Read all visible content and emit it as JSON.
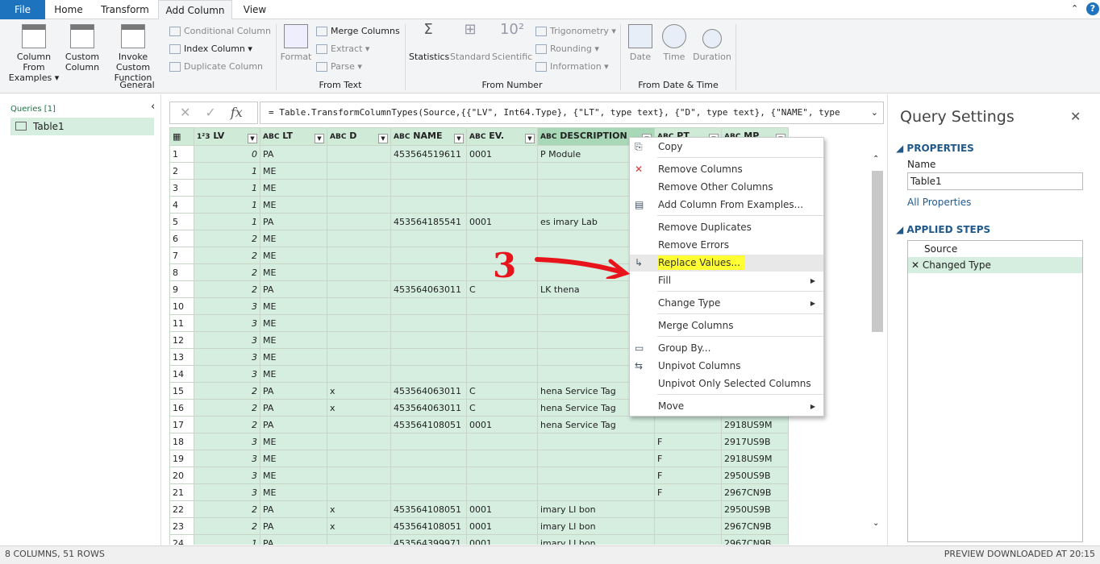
{
  "tabs": [
    "File",
    "Home",
    "Transform",
    "Add Column",
    "View"
  ],
  "ribbon": {
    "column_from_examples": "Column From Examples",
    "custom_column": "Custom Column",
    "invoke_custom_function": "Invoke Custom Function",
    "conditional_column": "Conditional Column",
    "index_column": "Index Column",
    "duplicate_column": "Duplicate Column",
    "general": "General",
    "format": "Format",
    "merge_columns": "Merge Columns",
    "extract": "Extract",
    "parse": "Parse",
    "from_text": "From Text",
    "statistics": "Statistics",
    "standard": "Standard",
    "scientific": "Scientific",
    "trigonometry": "Trigonometry",
    "rounding": "Rounding",
    "information": "Information",
    "from_number": "From Number",
    "date": "Date",
    "time": "Time",
    "duration": "Duration",
    "from_date_time": "From Date & Time"
  },
  "queries": {
    "title": "Queries [1]",
    "items": [
      "Table1"
    ]
  },
  "formula": "= Table.TransformColumnTypes(Source,{{\"LV\", Int64.Type}, {\"LT\", type text}, {\"D\", type text}, {\"NAME\", type",
  "columns": [
    {
      "type": "1²3",
      "name": "LV"
    },
    {
      "type": "ABC",
      "name": "LT"
    },
    {
      "type": "ABC",
      "name": "D"
    },
    {
      "type": "ABC",
      "name": "NAME"
    },
    {
      "type": "ABC",
      "name": "EV."
    },
    {
      "type": "ABC",
      "name": "DESCRIPTION"
    },
    {
      "type": "ABC",
      "name": "PT"
    },
    {
      "type": "ABC",
      "name": "MP"
    }
  ],
  "rows": [
    [
      "0",
      "PA",
      "",
      "453564519611",
      "0001",
      "P Module",
      "",
      ""
    ],
    [
      "1",
      "ME",
      "",
      "",
      "",
      "",
      "",
      ""
    ],
    [
      "1",
      "ME",
      "",
      "",
      "",
      "",
      "",
      ""
    ],
    [
      "1",
      "ME",
      "",
      "",
      "",
      "",
      "",
      ""
    ],
    [
      "1",
      "PA",
      "",
      "453564185541",
      "0001",
      "es imary Lab",
      "",
      ""
    ],
    [
      "2",
      "ME",
      "",
      "",
      "",
      "",
      "",
      ""
    ],
    [
      "2",
      "ME",
      "",
      "",
      "",
      "",
      "",
      ""
    ],
    [
      "2",
      "ME",
      "",
      "",
      "",
      "",
      "",
      ""
    ],
    [
      "2",
      "PA",
      "",
      "453564063011",
      "C",
      "LK thena",
      "",
      ""
    ],
    [
      "3",
      "ME",
      "",
      "",
      "",
      "",
      "",
      ""
    ],
    [
      "3",
      "ME",
      "",
      "",
      "",
      "",
      "",
      ""
    ],
    [
      "3",
      "ME",
      "",
      "",
      "",
      "",
      "",
      ""
    ],
    [
      "3",
      "ME",
      "",
      "",
      "",
      "",
      "",
      ""
    ],
    [
      "3",
      "ME",
      "",
      "",
      "",
      "",
      "",
      ""
    ],
    [
      "2",
      "PA",
      "x",
      "453564063011",
      "C",
      "hena Service Tag",
      "",
      ""
    ],
    [
      "2",
      "PA",
      "x",
      "453564063011",
      "C",
      "hena Service Tag",
      "",
      ""
    ],
    [
      "2",
      "PA",
      "",
      "453564108051",
      "0001",
      "hena Service Tag",
      "",
      "2918US9M"
    ],
    [
      "3",
      "ME",
      "",
      "",
      "",
      "",
      "F",
      "2917US9B"
    ],
    [
      "3",
      "ME",
      "",
      "",
      "",
      "",
      "F",
      "2918US9M"
    ],
    [
      "3",
      "ME",
      "",
      "",
      "",
      "",
      "F",
      "2950US9B"
    ],
    [
      "3",
      "ME",
      "",
      "",
      "",
      "",
      "F",
      "2967CN9B"
    ],
    [
      "2",
      "PA",
      "x",
      "453564108051",
      "0001",
      "imary LI bon",
      "",
      "2950US9B"
    ],
    [
      "2",
      "PA",
      "x",
      "453564108051",
      "0001",
      "imary LI bon",
      "",
      "2967CN9B"
    ],
    [
      "1",
      "PA",
      "",
      "453564399971",
      "0001",
      "imary LI bon",
      "",
      "2967CN9B"
    ]
  ],
  "menu": [
    "Copy",
    "Remove Columns",
    "Remove Other Columns",
    "Add Column From Examples...",
    "Remove Duplicates",
    "Remove Errors",
    "Replace Values...",
    "Fill",
    "Change Type",
    "Merge Columns",
    "Group By...",
    "Unpivot Columns",
    "Unpivot Only Selected Columns",
    "Move"
  ],
  "annotation": "3",
  "settings": {
    "title": "Query Settings",
    "properties": "PROPERTIES",
    "name_label": "Name",
    "name_value": "Table1",
    "all_properties": "All Properties",
    "applied_steps": "APPLIED STEPS",
    "steps": [
      "Source",
      "Changed Type"
    ]
  },
  "status": {
    "left": "8 COLUMNS, 51 ROWS",
    "right": "PREVIEW DOWNLOADED AT 20:15"
  },
  "colors": {
    "file_tab": "#1e73be",
    "accent": "#217346",
    "highlight": "#ffff33",
    "annotation": "#e8141c"
  }
}
